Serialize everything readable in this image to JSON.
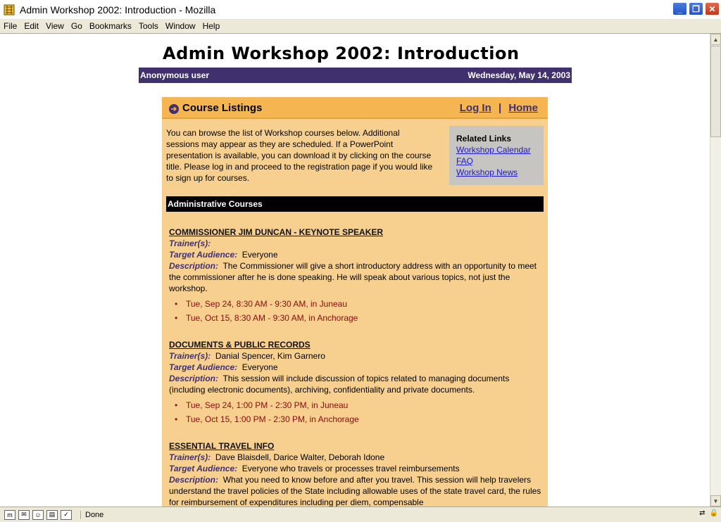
{
  "window": {
    "title": "Admin Workshop 2002: Introduction - Mozilla"
  },
  "menu": [
    "File",
    "Edit",
    "View",
    "Go",
    "Bookmarks",
    "Tools",
    "Window",
    "Help"
  ],
  "page": {
    "title": "Admin Workshop 2002: Introduction",
    "user": "Anonymous user",
    "date": "Wednesday, May 14, 2003"
  },
  "panel": {
    "title": "Course Listings",
    "login": "Log In",
    "separator": "|",
    "home": "Home",
    "intro": "You can browse the list of Workshop courses below. Additional sessions may appear as they are scheduled. If a PowerPoint presentation is available, you can download it by clicking on the course title. Please log in and proceed to the registration page if you would like to sign up for courses.",
    "related": {
      "title": "Related Links",
      "links": [
        "Workshop Calendar",
        "FAQ",
        "Workshop News"
      ]
    },
    "section": "Administrative Courses"
  },
  "labels": {
    "trainers": "Trainer(s):",
    "audience": "Target Audience:",
    "description": "Description:"
  },
  "courses": [
    {
      "title": "COMMISSIONER JIM DUNCAN - KEYNOTE SPEAKER",
      "trainers": "",
      "audience": "Everyone",
      "description": "The Commissioner will give a short introductory address with an opportunity to meet the commissioner after he is done speaking. He will speak about various topics, not just the workshop.",
      "sessions": [
        "Tue, Sep 24, 8:30 AM - 9:30 AM, in Juneau",
        "Tue, Oct 15, 8:30 AM - 9:30 AM, in Anchorage"
      ]
    },
    {
      "title": "DOCUMENTS & PUBLIC RECORDS",
      "trainers": "Danial Spencer, Kim Garnero",
      "audience": "Everyone",
      "description": "This session will include discussion of topics related to managing documents (including electronic documents), archiving, confidentiality and private documents.",
      "sessions": [
        "Tue, Sep 24, 1:00 PM - 2:30 PM, in Juneau",
        "Tue, Oct 15, 1:00 PM - 2:30 PM, in Anchorage"
      ]
    },
    {
      "title": "ESSENTIAL TRAVEL INFO",
      "trainers": "Dave Blaisdell, Darice Walter, Deborah Idone",
      "audience": "Everyone who travels or processes travel reimbursements",
      "description": "What you need to know before and after you travel. This session will help travelers understand the travel policies of the State including allowable uses of the state travel card, the rules for reimbursement of expenditures including per diem, compensable"
    }
  ],
  "status": {
    "text": "Done"
  }
}
